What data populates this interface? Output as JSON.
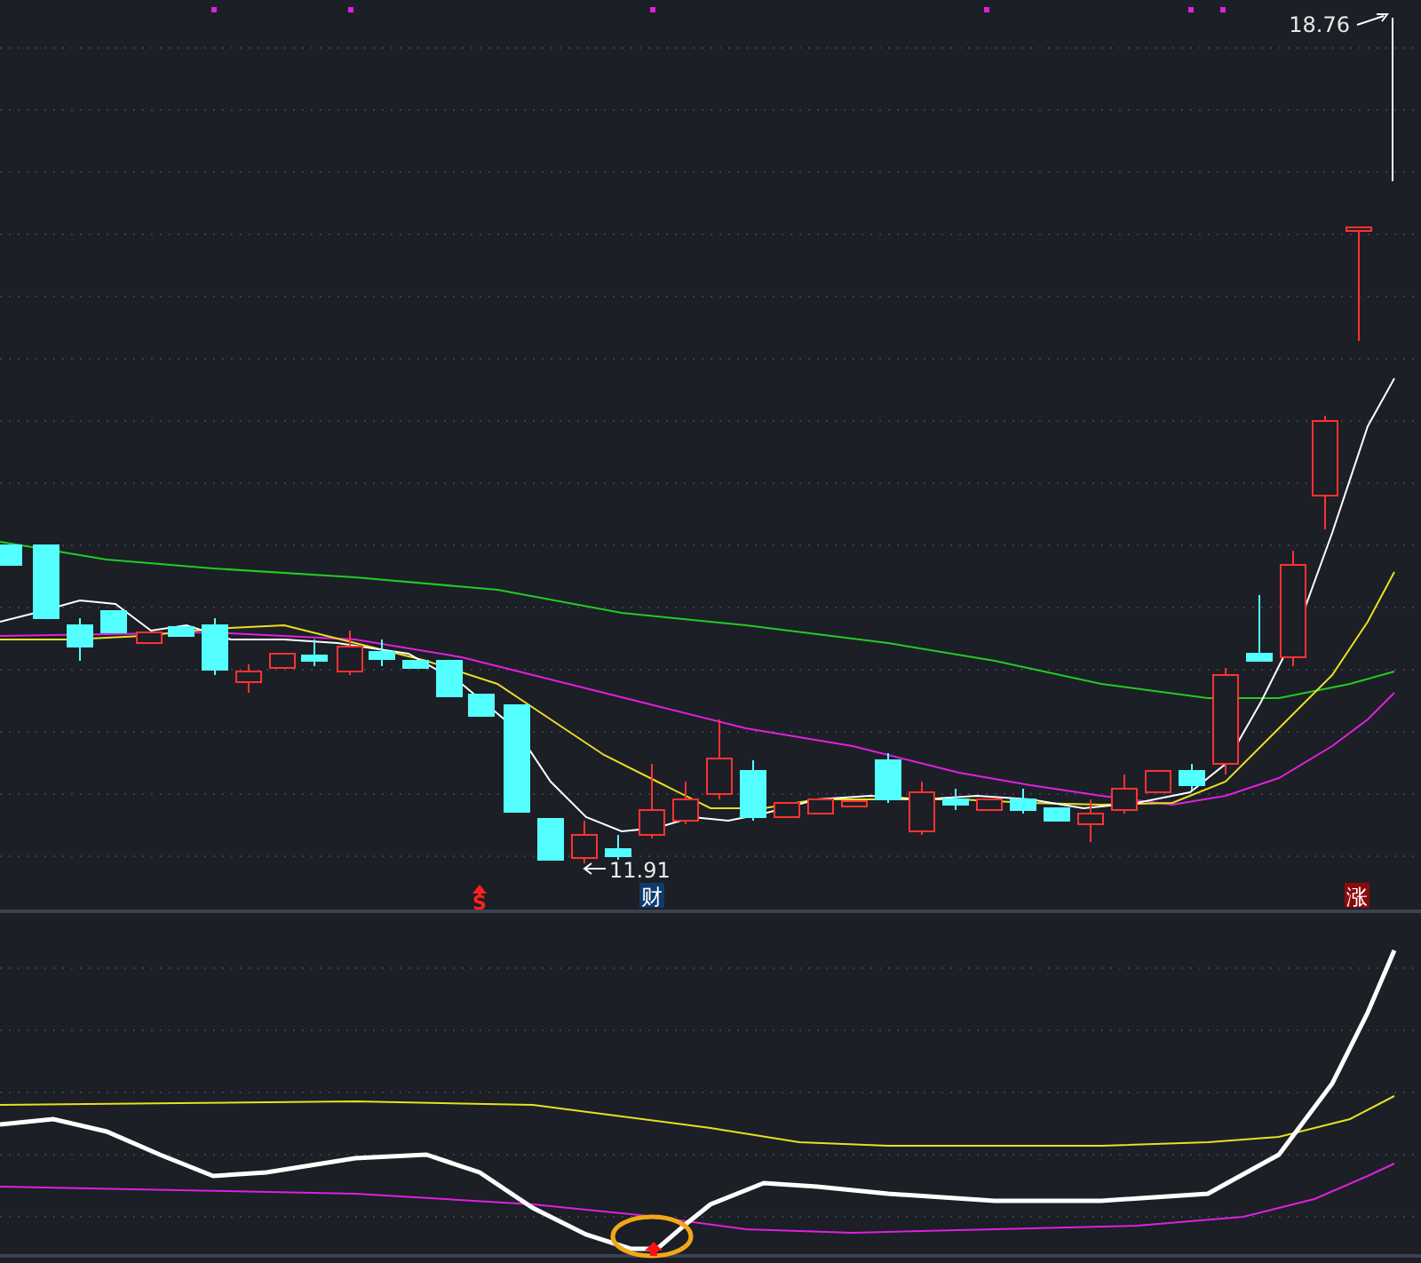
{
  "price_chart": {
    "high_label": "18.76",
    "low_label": "11.91"
  },
  "markers": [
    {
      "text": "S",
      "kind": "sell"
    },
    {
      "text": "财",
      "kind": "finance"
    },
    {
      "text": "涨",
      "kind": "limit-up"
    }
  ]
}
